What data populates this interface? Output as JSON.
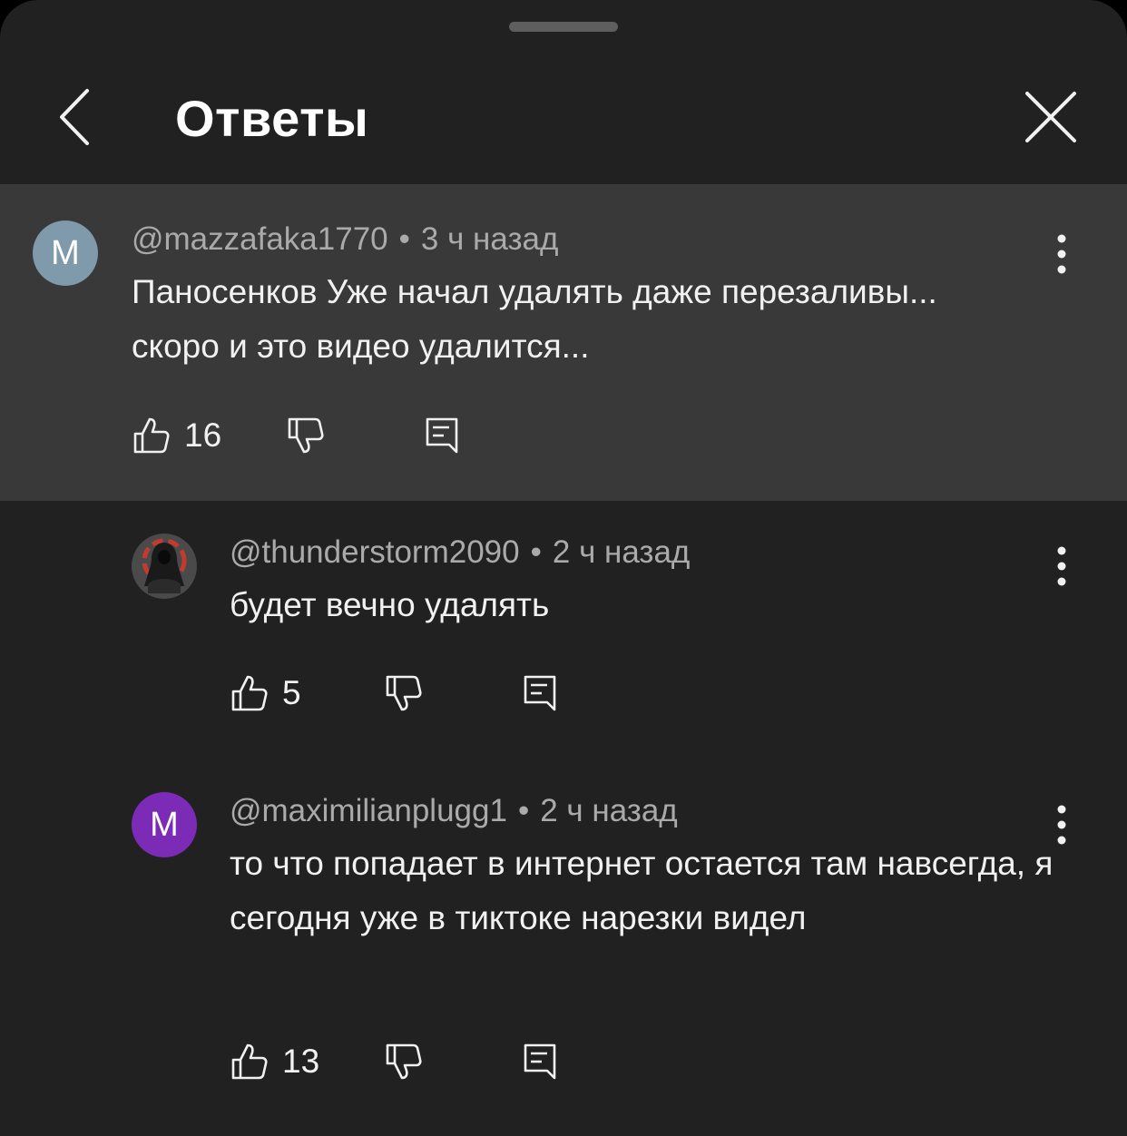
{
  "header": {
    "title": "Ответы"
  },
  "comments": [
    {
      "avatar_letter": "M",
      "avatar_color": "#7f9aab",
      "author": "@mazzafaka1770",
      "time": "3 ч назад",
      "text": "Паносенков Уже начал удалять даже перезаливы... скоро и это видео удалится...",
      "likes": "16"
    },
    {
      "avatar_letter": "",
      "avatar_color": "#3c3c3c",
      "author": "@thunderstorm2090",
      "time": "2 ч назад",
      "text": "будет вечно удалять",
      "likes": "5"
    },
    {
      "avatar_letter": "M",
      "avatar_color": "#7b2bb5",
      "author": "@maximilianplugg1",
      "time": "2 ч назад",
      "text": "то что попадает в интернет остается там навсегда, я сегодня уже в тиктоке нарезки видел",
      "likes": "13"
    }
  ],
  "separator": "•",
  "icons": {
    "back": "chevron-left-icon",
    "close": "close-icon",
    "more": "more-vert-icon",
    "like": "thumb-up-icon",
    "dislike": "thumb-down-icon",
    "reply": "reply-icon"
  }
}
